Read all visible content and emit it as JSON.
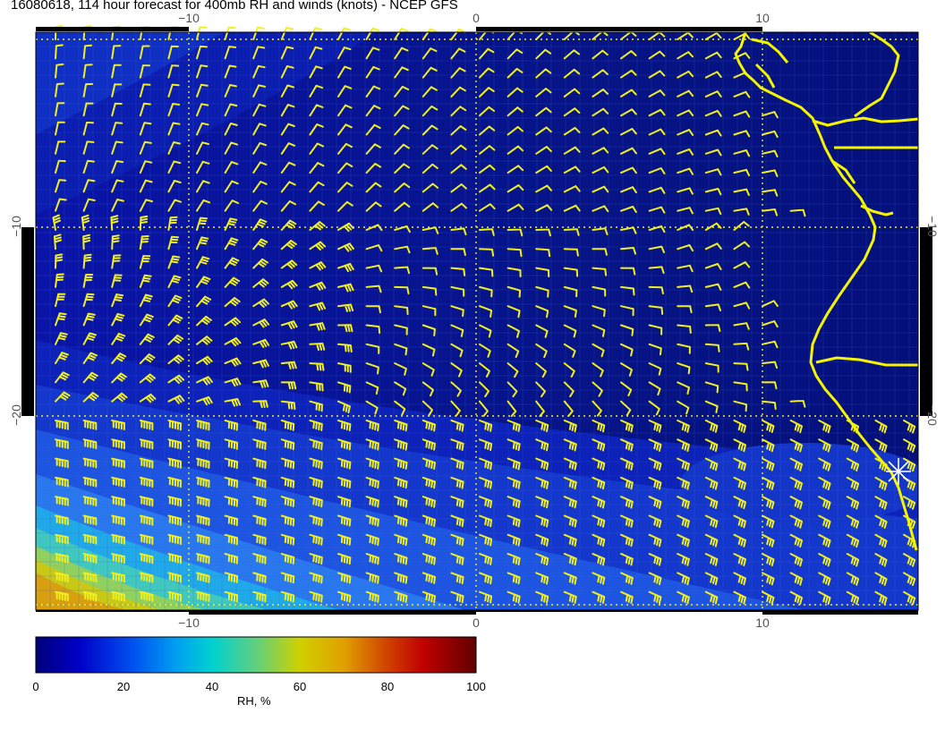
{
  "title": "16080618, 114 hour forecast for 400mb RH and winds (knots) - NCEP GFS",
  "map": {
    "lon_range": [
      -15.5,
      15.5
    ],
    "lat_range": [
      -30,
      0.5
    ],
    "lon_ticks": [
      {
        "value": -10,
        "label": "−10"
      },
      {
        "value": 0,
        "label": "0"
      },
      {
        "value": 10,
        "label": "10"
      }
    ],
    "lat_ticks": [
      {
        "value": -10,
        "label": "−10"
      },
      {
        "value": -20,
        "label": "−20"
      }
    ],
    "gridlines": "dotted yellow at 10° intervals",
    "coastline_color": "#f5f500",
    "barb_color": "#f0f020",
    "station_marker": "white star"
  },
  "colorbar": {
    "label": "RH, %",
    "ticks": [
      "0",
      "20",
      "40",
      "60",
      "80",
      "100"
    ],
    "range": [
      0,
      100
    ]
  }
}
